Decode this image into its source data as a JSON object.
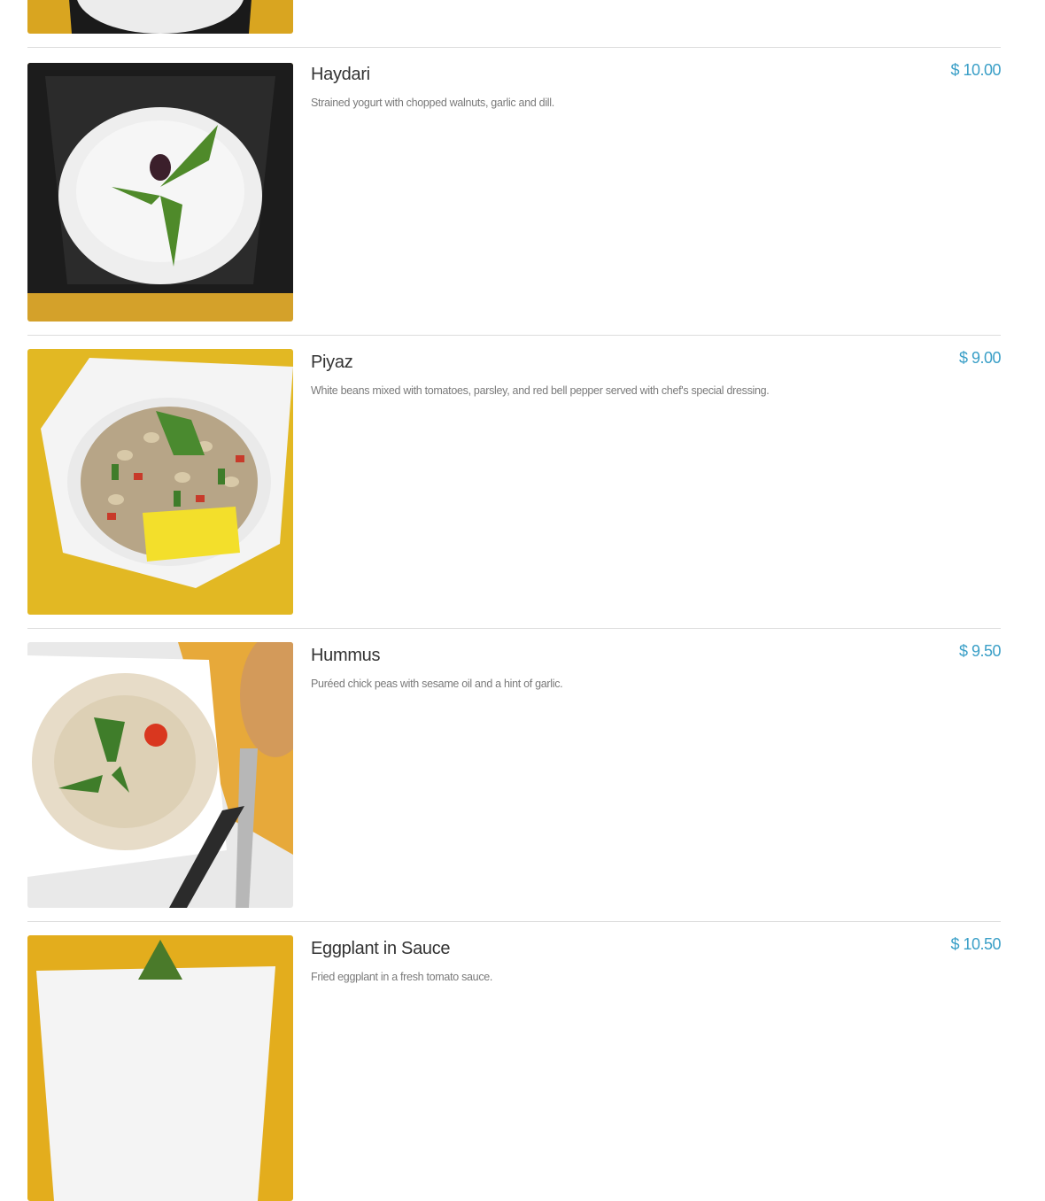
{
  "menu": {
    "items": [
      {
        "name": "",
        "description": "",
        "price": "",
        "photo_icon": "yogurt-dish-photo"
      },
      {
        "name": "Haydari",
        "description": "Strained yogurt with chopped walnuts, garlic and dill.",
        "price": "$ 10.00",
        "photo_icon": "yogurt-dish-photo"
      },
      {
        "name": "Piyaz",
        "description": "White beans mixed with tomatoes, parsley, and red bell pepper served with chef's special dressing.",
        "price": "$ 9.00",
        "photo_icon": "bean-salad-photo"
      },
      {
        "name": "Hummus",
        "description": "Puréed chick peas with sesame oil and a hint of garlic.",
        "price": "$ 9.50",
        "photo_icon": "hummus-photo"
      },
      {
        "name": "Eggplant in Sauce",
        "description": "Fried eggplant in a fresh tomato sauce.",
        "price": "$ 10.50",
        "photo_icon": "eggplant-dish-photo"
      }
    ]
  },
  "colors": {
    "price": "#3a9fc7",
    "name": "#333333",
    "description": "#7a7a7a",
    "divider": "#dddddd"
  }
}
